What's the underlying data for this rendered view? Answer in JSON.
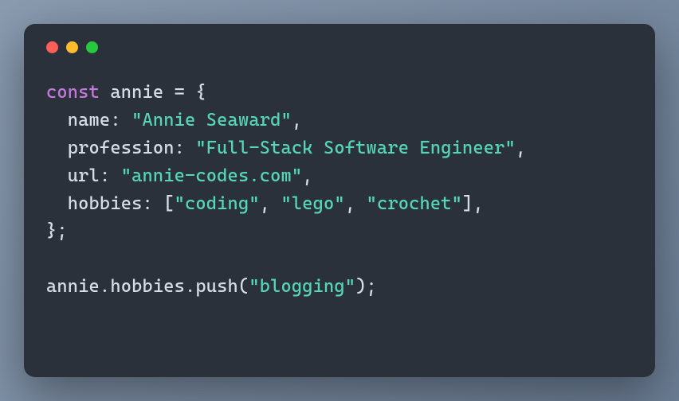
{
  "window": {
    "buttons": [
      "close",
      "minimize",
      "zoom"
    ]
  },
  "code": {
    "keyword": "const",
    "varName": "annie",
    "equals": " = ",
    "openBrace": "{",
    "props": {
      "name": {
        "key": "name",
        "value": "\"Annie Seaward\""
      },
      "profession": {
        "key": "profession",
        "value": "\"Full-Stack Software Engineer\""
      },
      "url": {
        "key": "url",
        "value": "\"annie-codes.com\""
      },
      "hobbies": {
        "key": "hobbies",
        "open": "[",
        "items": [
          "\"coding\"",
          "\"lego\"",
          "\"crochet\""
        ],
        "close": "]"
      }
    },
    "closeBrace": "};",
    "call": {
      "object": "annie",
      "dot1": ".",
      "prop": "hobbies",
      "dot2": ".",
      "method": "push",
      "open": "(",
      "arg": "\"blogging\"",
      "close": ");"
    }
  }
}
